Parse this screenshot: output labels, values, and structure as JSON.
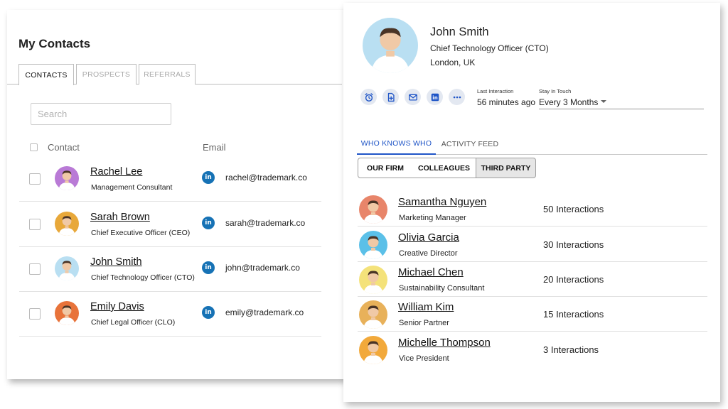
{
  "contacts_panel": {
    "title": "My Contacts",
    "tabs": [
      {
        "label": "CONTACTS",
        "active": true
      },
      {
        "label": "PROSPECTS",
        "active": false
      },
      {
        "label": "REFERRALS",
        "active": false
      }
    ],
    "search_placeholder": "Search",
    "columns": {
      "contact": "Contact",
      "email": "Email"
    },
    "rows": [
      {
        "name": "Rachel Lee",
        "role": "Management Consultant",
        "email": "rachel@trademark.co",
        "avatar_bg": "#b97ad6"
      },
      {
        "name": "Sarah Brown",
        "role": "Chief Executive Officer (CEO)",
        "email": "sarah@trademark.co",
        "avatar_bg": "#e8a83a"
      },
      {
        "name": "John Smith",
        "role": "Chief Technology Officer (CTO)",
        "email": "john@trademark.co",
        "avatar_bg": "#b9dff2"
      },
      {
        "name": "Emily Davis",
        "role": "Chief Legal Officer (CLO)",
        "email": "emily@trademark.co",
        "avatar_bg": "#e8733a"
      }
    ]
  },
  "profile_panel": {
    "name": "John Smith",
    "title": "Chief Technology Officer (CTO)",
    "location": "London, UK",
    "actions": [
      {
        "icon": "alarm-clock-icon"
      },
      {
        "icon": "document-add-icon"
      },
      {
        "icon": "mail-icon"
      },
      {
        "icon": "linkedin-icon"
      },
      {
        "icon": "more-icon"
      }
    ],
    "last_interaction": {
      "label": "Last Interaction",
      "value": "56 minutes ago"
    },
    "stay_in_touch": {
      "label": "Stay In Touch",
      "value": "Every 3 Months"
    },
    "tabs": [
      {
        "label": "WHO KNOWS WHO",
        "active": true
      },
      {
        "label": "ACTIVITY FEED",
        "active": false
      }
    ],
    "segments": [
      {
        "label": "OUR FIRM",
        "active": false
      },
      {
        "label": "COLLEAGUES",
        "active": false
      },
      {
        "label": "THIRD PARTY",
        "active": true
      }
    ],
    "connections": [
      {
        "name": "Samantha Nguyen",
        "role": "Marketing Manager",
        "interactions": "50 Interactions",
        "avatar_bg": "#e8856a"
      },
      {
        "name": "Olivia Garcia",
        "role": "Creative Director",
        "interactions": "30 Interactions",
        "avatar_bg": "#5bc0e8"
      },
      {
        "name": "Michael Chen",
        "role": "Sustainability Consultant",
        "interactions": "20 Interactions",
        "avatar_bg": "#f4e27a"
      },
      {
        "name": "William Kim",
        "role": "Senior Partner",
        "interactions": "15 Interactions",
        "avatar_bg": "#e8b15a"
      },
      {
        "name": "Michelle Thompson",
        "role": "Vice President",
        "interactions": "3 Interactions",
        "avatar_bg": "#f2a93b"
      }
    ]
  },
  "colors": {
    "accent": "#1f55c7",
    "linkedin": "#1672b5",
    "action_bg": "#e3e8f1"
  }
}
